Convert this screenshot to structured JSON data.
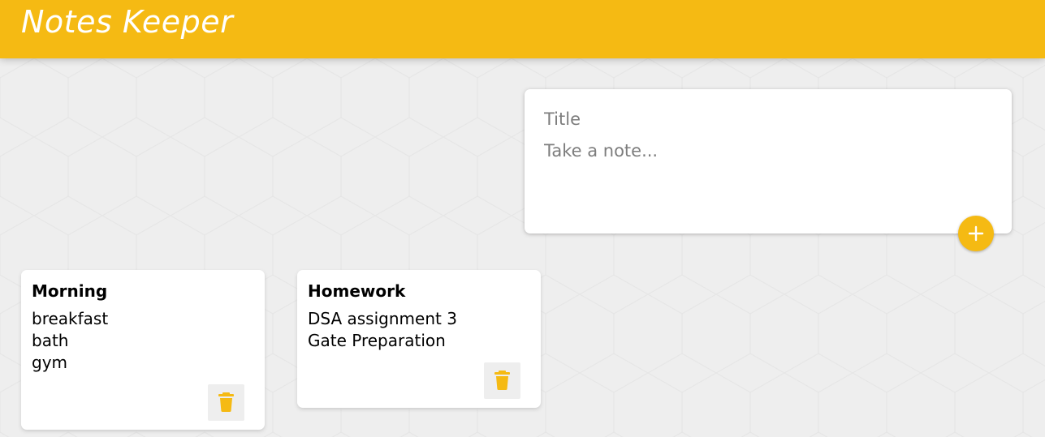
{
  "app": {
    "title": "Notes Keeper"
  },
  "create_note": {
    "title_placeholder": "Title",
    "content_placeholder": "Take a note...",
    "add_icon": "plus-icon"
  },
  "notes": [
    {
      "title": "Morning",
      "lines": [
        "breakfast",
        "bath",
        "gym"
      ],
      "delete_icon": "trash-icon"
    },
    {
      "title": "Homework",
      "lines": [
        "DSA assignment 3",
        "Gate Preparation"
      ],
      "delete_icon": "trash-icon"
    }
  ],
  "colors": {
    "accent": "#f5ba13",
    "background": "#eeeeee",
    "card": "#ffffff"
  }
}
